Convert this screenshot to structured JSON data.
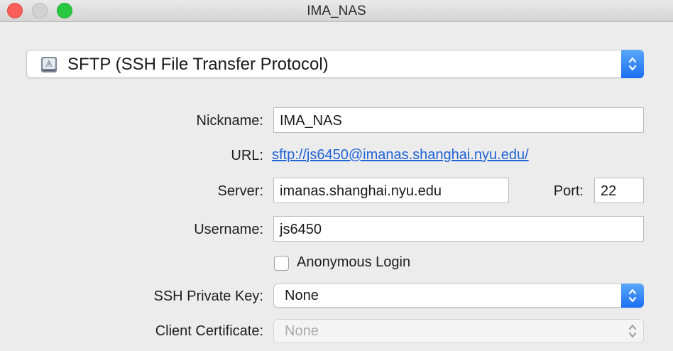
{
  "window": {
    "title": "IMA_NAS"
  },
  "protocol": {
    "selected": "SFTP (SSH File Transfer Protocol)"
  },
  "form": {
    "nickname_label": "Nickname:",
    "nickname_value": "IMA_NAS",
    "url_label": "URL:",
    "url_value": "sftp://js6450@imanas.shanghai.nyu.edu/",
    "server_label": "Server:",
    "server_value": "imanas.shanghai.nyu.edu",
    "port_label": "Port:",
    "port_value": "22",
    "username_label": "Username:",
    "username_value": "js6450",
    "anonymous_label": "Anonymous Login",
    "anonymous_checked": false,
    "ssh_key_label": "SSH Private Key:",
    "ssh_key_value": "None",
    "client_cert_label": "Client Certificate:",
    "client_cert_value": "None"
  },
  "colors": {
    "accent": "#1b6ef3",
    "link": "#1f63d6",
    "close": "#fc5f57",
    "maximize": "#28c840"
  },
  "icons": [
    "close-icon",
    "minimize-icon",
    "maximize-icon",
    "drive-icon",
    "up-down-chevron-icon"
  ]
}
